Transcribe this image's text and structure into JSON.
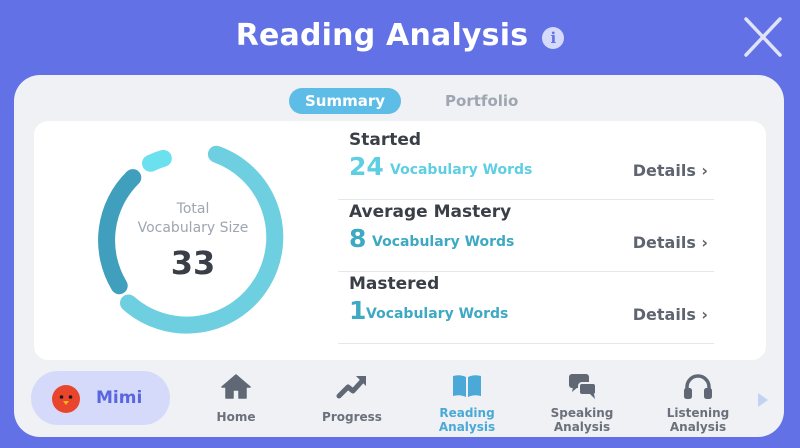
{
  "header": {
    "title": "Reading Analysis",
    "info_icon": "info-icon",
    "close_icon": "close-icon"
  },
  "tabs": [
    {
      "label": "Summary",
      "active": true
    },
    {
      "label": "Portfolio",
      "active": false
    }
  ],
  "total": {
    "label_line1": "Total",
    "label_line2": "Vocabulary Size",
    "value": "33"
  },
  "stats": [
    {
      "title": "Started",
      "count": "24",
      "unit": "Vocabulary Words",
      "link": "Details ›"
    },
    {
      "title": "Average Mastery",
      "count": "8",
      "unit": "Vocabulary Words",
      "link": "Details ›"
    },
    {
      "title": "Mastered",
      "count": "1",
      "unit": "Vocabulary Words",
      "link": "Details ›"
    }
  ],
  "profile": {
    "name": "Mimi",
    "avatar_icon": "red-bird-avatar"
  },
  "nav": [
    {
      "line1": "Home",
      "line2": "",
      "icon": "home-icon",
      "active": false
    },
    {
      "line1": "Progress",
      "line2": "",
      "icon": "trend-arrow-icon",
      "active": false
    },
    {
      "line1": "Reading",
      "line2": "Analysis",
      "icon": "book-icon",
      "active": true
    },
    {
      "line1": "Speaking",
      "line2": "Analysis",
      "icon": "speech-bubbles-icon",
      "active": false
    },
    {
      "line1": "Listening",
      "line2": "Analysis",
      "icon": "headphones-icon",
      "active": false
    }
  ],
  "colors": {
    "background": "#6271e6",
    "accent": "#5ecfe2",
    "active_tab": "#5dbde6"
  }
}
